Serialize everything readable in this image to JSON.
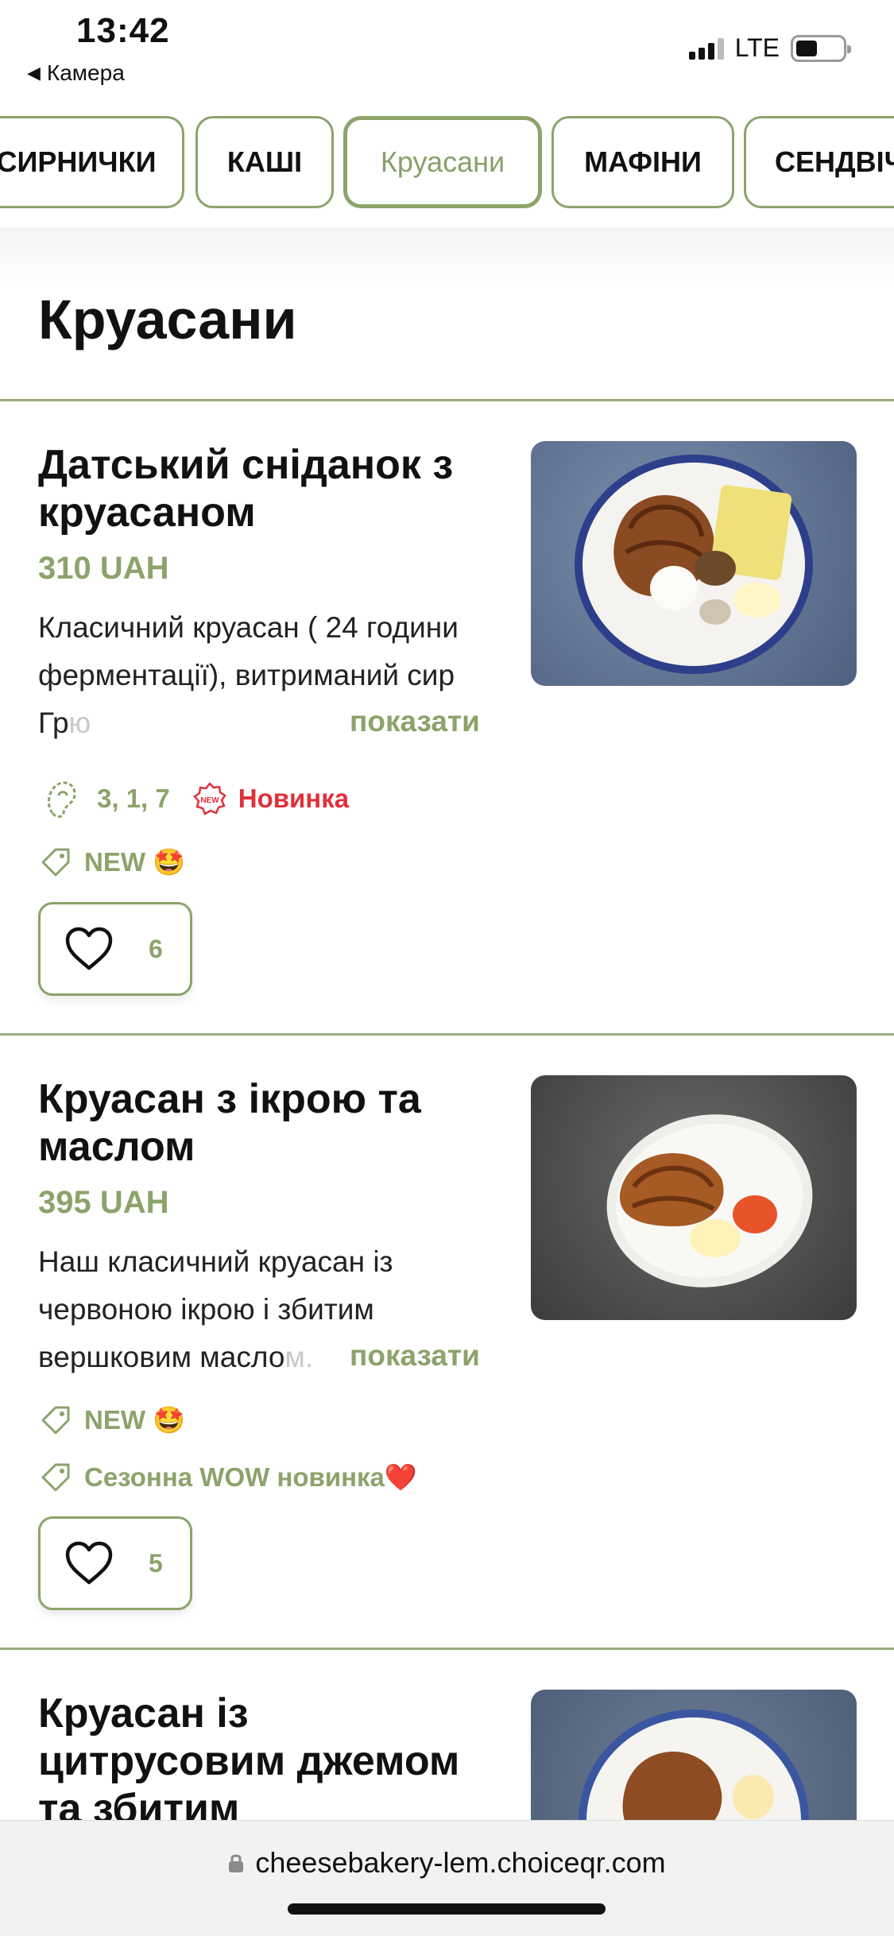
{
  "status_bar": {
    "time": "13:42",
    "back_app": "Камера",
    "network": "LTE"
  },
  "tabs": [
    {
      "label": "СИРНИЧКИ",
      "active": false
    },
    {
      "label": "КАШІ",
      "active": false
    },
    {
      "label": "Круасани",
      "active": true
    },
    {
      "label": "МАФІНИ",
      "active": false
    },
    {
      "label": "СЕНДВІЧ",
      "active": false
    }
  ],
  "section": {
    "title": "Круасани"
  },
  "items": [
    {
      "title": "Датський сніданок з круасаном",
      "price": "310 UAH",
      "description": "Класичний круасан ( 24 години ферментації), витриманий сир Гр",
      "description_fade": "ю",
      "show_more": "показати",
      "allergens": "3, 1, 7",
      "badge": "Новинка",
      "tags": [
        "NEW 🤩"
      ],
      "likes": "6",
      "photo_icon": "croissant-breakfast-photo"
    },
    {
      "title": "Круасан з ікрою та маслом",
      "price": "395 UAH",
      "description": "Наш класичний круасан із червоною ікрою і збитим вершковим масло",
      "description_fade": "м.",
      "show_more": "показати",
      "tags": [
        "NEW 🤩",
        "Сезонна WOW новинка❤️"
      ],
      "likes": "5",
      "photo_icon": "croissant-caviar-photo"
    },
    {
      "title": "Круасан із цитрусовим джемом та збитим",
      "photo_icon": "croissant-jam-photo"
    }
  ],
  "browser": {
    "url": "cheesebakery-lem.choiceqr.com"
  },
  "colors": {
    "accent": "#8ca36a",
    "badge_red": "#e0303a"
  }
}
